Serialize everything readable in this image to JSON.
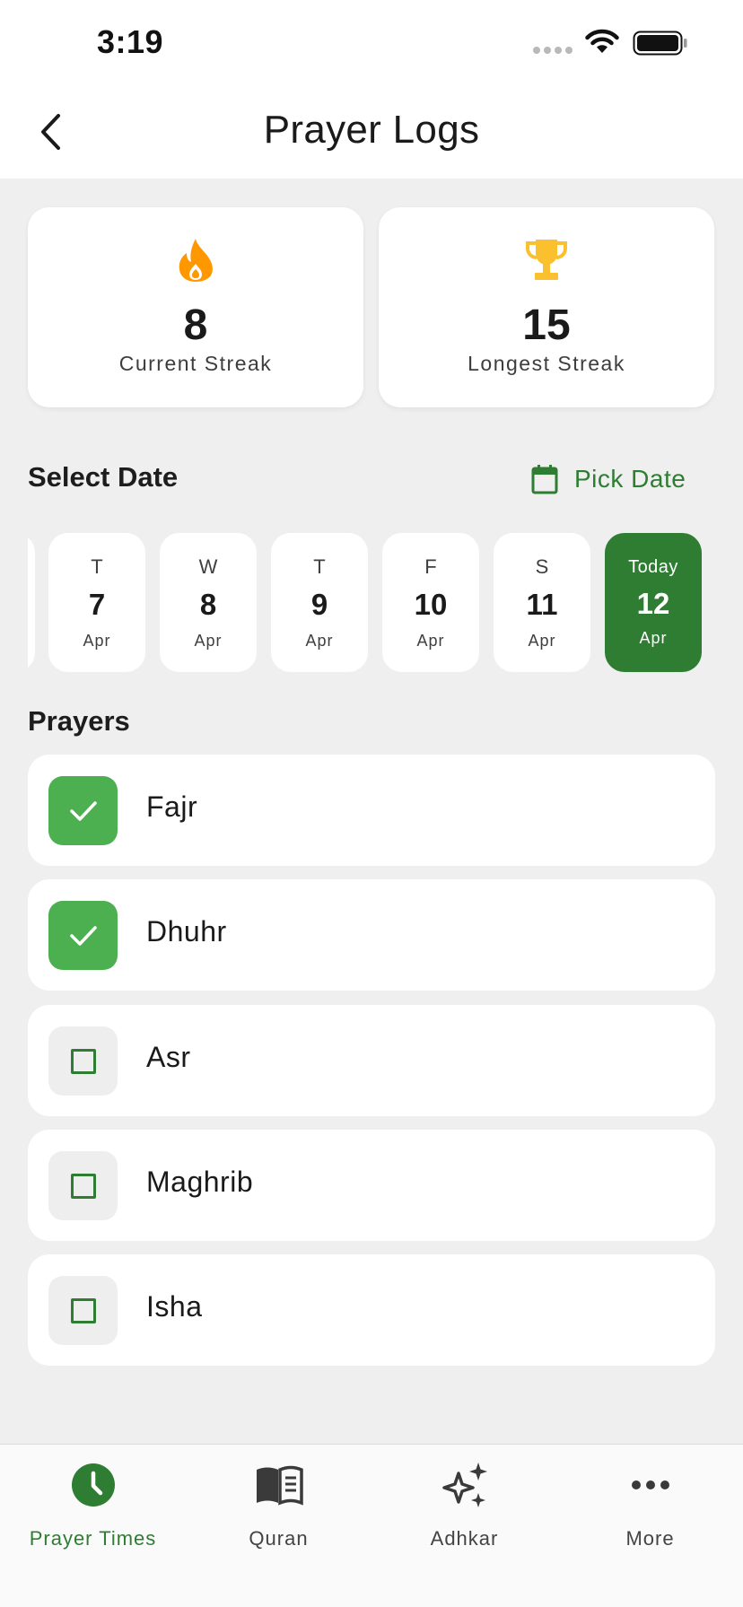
{
  "status_bar": {
    "time": "3:19"
  },
  "header": {
    "title": "Prayer Logs"
  },
  "streaks": {
    "current": {
      "value": "8",
      "label": "Current Streak",
      "icon": "flame-icon",
      "color": "#ff9800"
    },
    "longest": {
      "value": "15",
      "label": "Longest Streak",
      "icon": "trophy-icon",
      "color": "#fbc02d"
    }
  },
  "date_section": {
    "title": "Select Date",
    "pick_date_label": "Pick Date",
    "dates": [
      {
        "dow": "T",
        "day": "7",
        "month": "Apr",
        "selected": false
      },
      {
        "dow": "W",
        "day": "8",
        "month": "Apr",
        "selected": false
      },
      {
        "dow": "T",
        "day": "9",
        "month": "Apr",
        "selected": false
      },
      {
        "dow": "F",
        "day": "10",
        "month": "Apr",
        "selected": false
      },
      {
        "dow": "S",
        "day": "11",
        "month": "Apr",
        "selected": false
      },
      {
        "dow": "Today",
        "day": "12",
        "month": "Apr",
        "selected": true
      }
    ]
  },
  "prayers": {
    "title": "Prayers",
    "items": [
      {
        "name": "Fajr",
        "checked": true
      },
      {
        "name": "Dhuhr",
        "checked": true
      },
      {
        "name": "Asr",
        "checked": false
      },
      {
        "name": "Maghrib",
        "checked": false
      },
      {
        "name": "Isha",
        "checked": false
      }
    ]
  },
  "bottom_nav": {
    "items": [
      {
        "label": "Prayer Times",
        "icon": "clock-icon",
        "active": true
      },
      {
        "label": "Quran",
        "icon": "book-icon",
        "active": false
      },
      {
        "label": "Adhkar",
        "icon": "sparkles-icon",
        "active": false
      },
      {
        "label": "More",
        "icon": "more-icon",
        "active": false
      }
    ]
  },
  "colors": {
    "primary": "#2e7d32",
    "checked": "#4caf50",
    "background": "#efefef"
  }
}
